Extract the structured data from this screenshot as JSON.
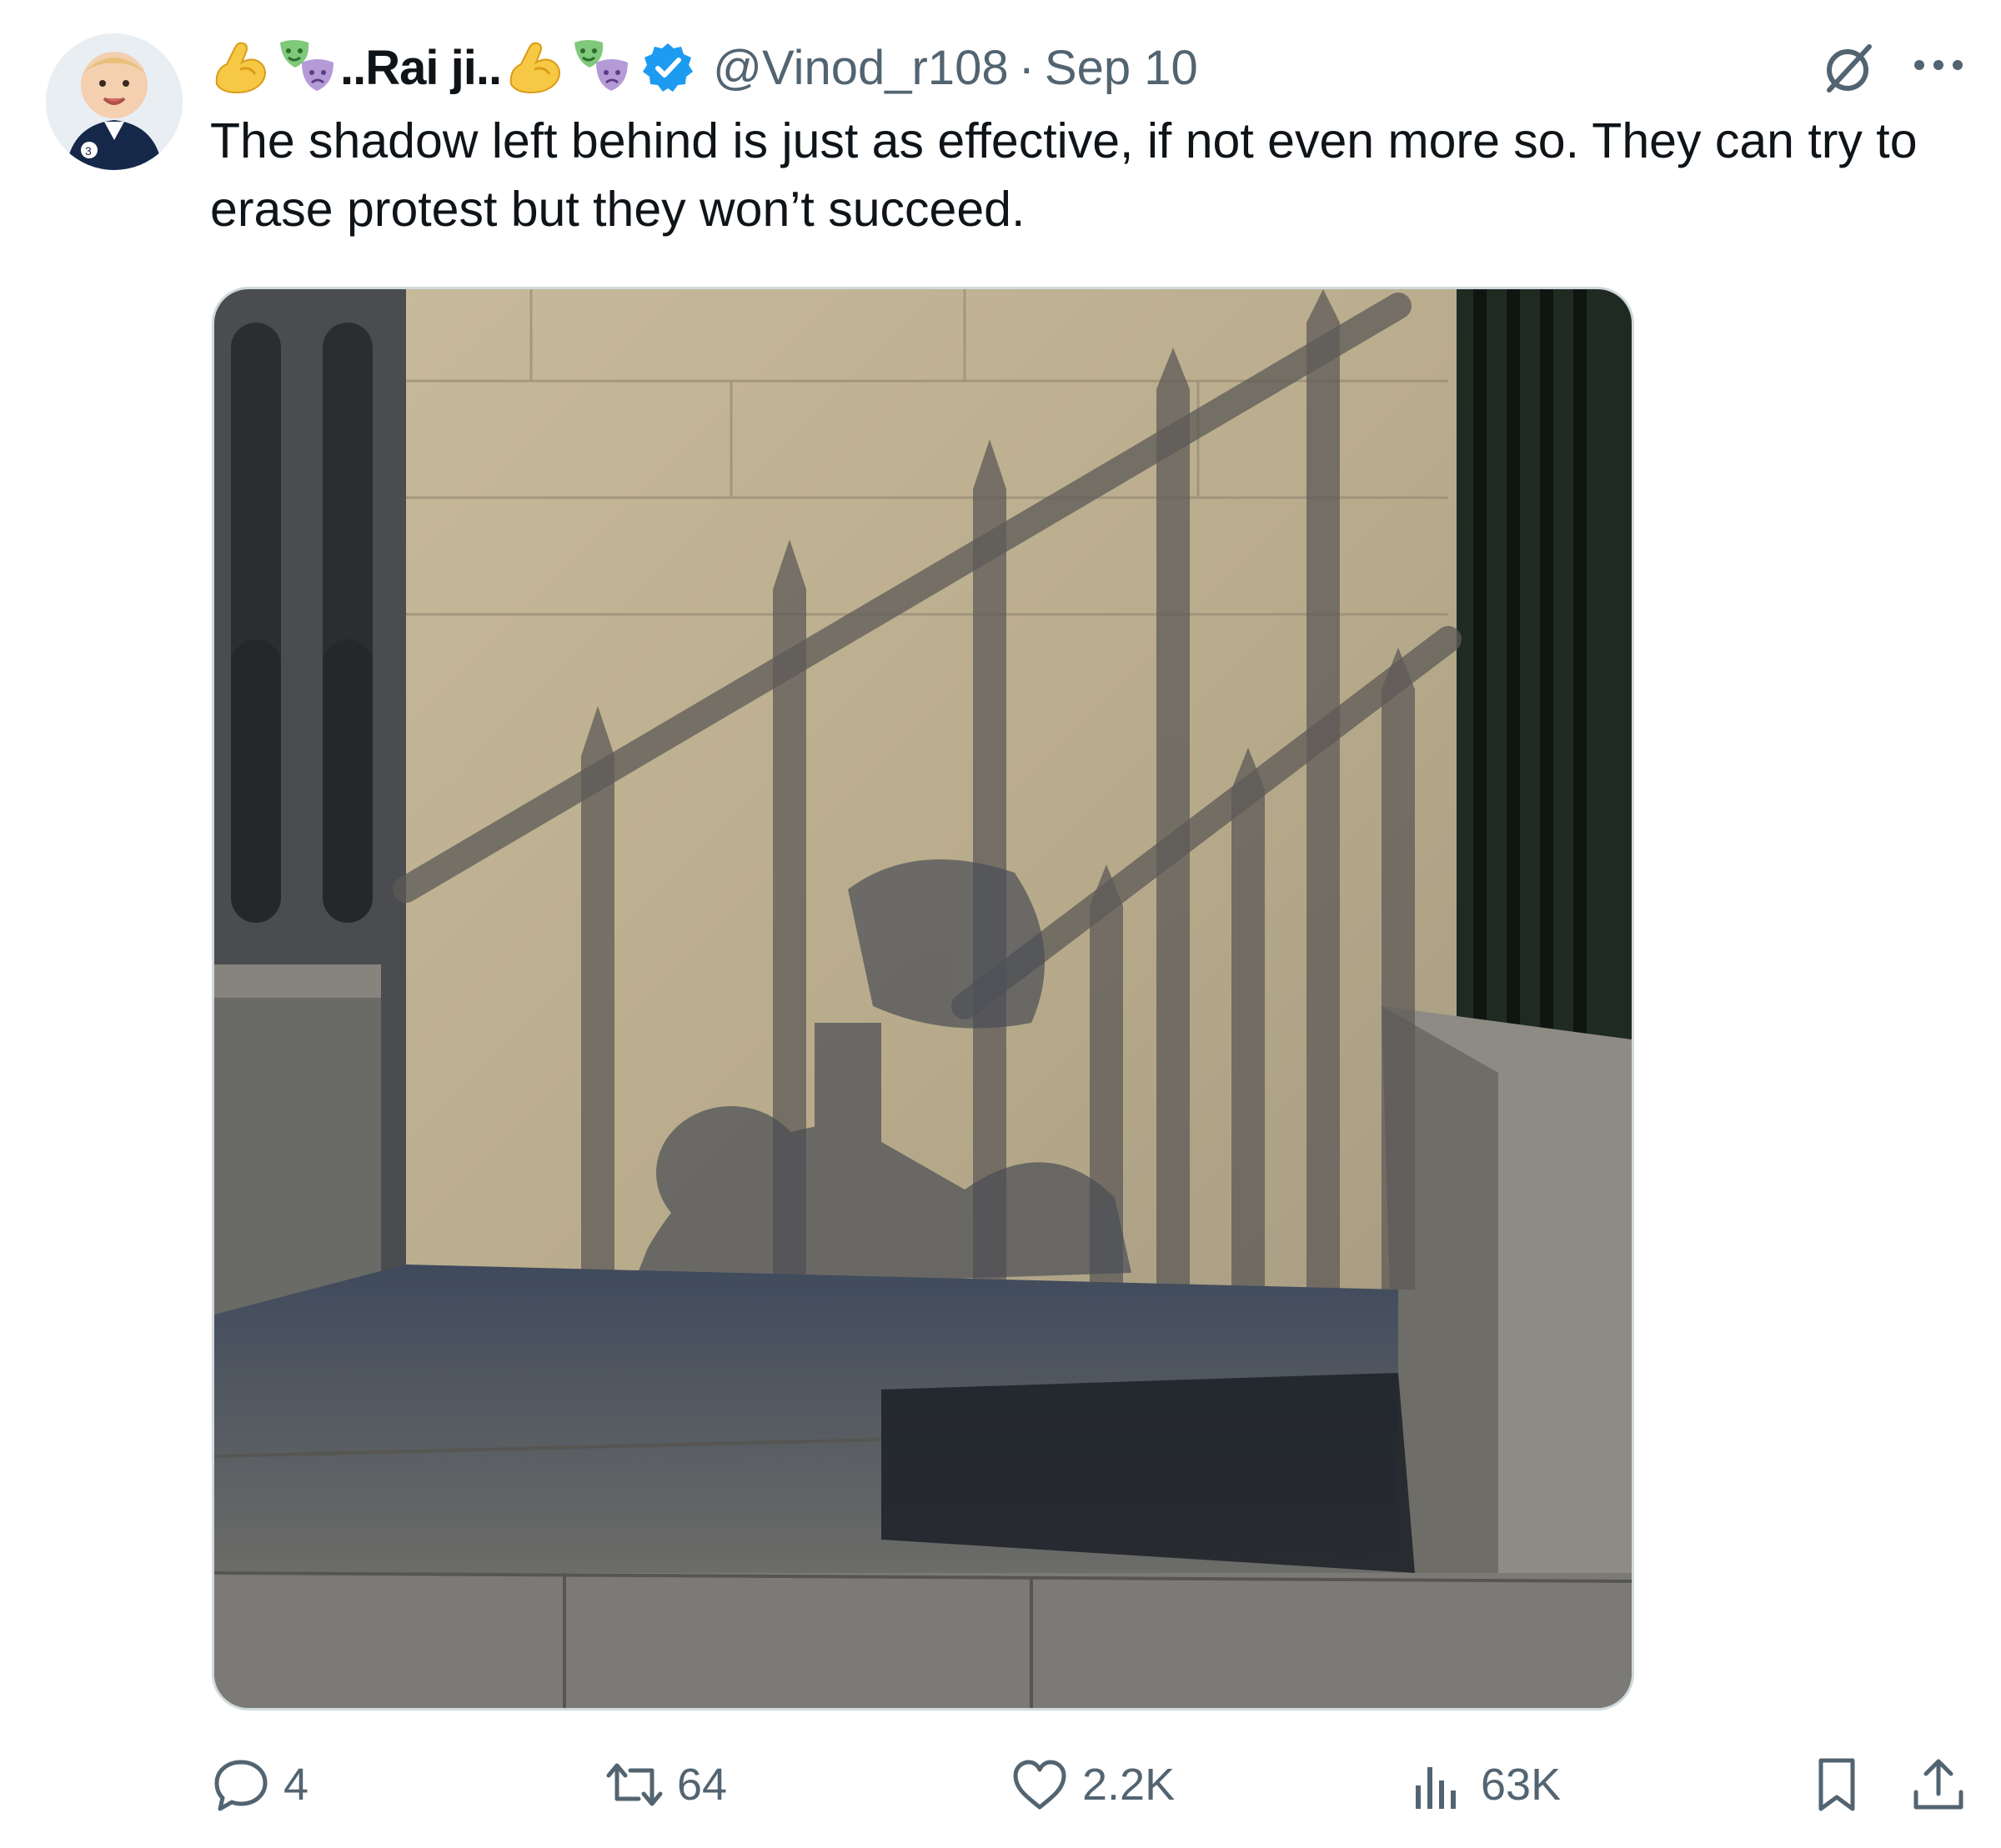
{
  "tweet": {
    "display_name": "..Rai ji..",
    "handle": "@Vinod_r108",
    "separator": "·",
    "date": "Sep 10",
    "text": "The shadow left behind is just as effective, if not even more so. They can try to erase protest but they won’t succeed.",
    "header_emojis": [
      "flexed-biceps",
      "performing-arts-masks"
    ],
    "verified": true
  },
  "actions": {
    "replies": "4",
    "reposts": "64",
    "likes": "2.2K",
    "views": "63K"
  },
  "colors": {
    "text": "#0f1419",
    "secondary": "#536471",
    "verified_badge": "#1d9bf0",
    "media_border": "#cfd9de"
  },
  "icons": [
    "grok-icon",
    "more-icon",
    "reply-icon",
    "repost-icon",
    "like-icon",
    "views-icon",
    "bookmark-icon",
    "share-icon"
  ]
}
